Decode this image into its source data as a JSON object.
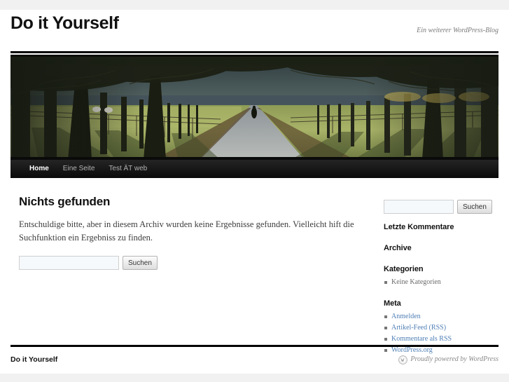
{
  "site": {
    "title": "Do it Yourself",
    "description": "Ein weiterer WordPress-Blog"
  },
  "header_image": {
    "icon": "tree-lined-path-photo",
    "alt": "Allee mit Bäumen und Weg"
  },
  "nav": {
    "items": [
      {
        "label": "Home",
        "current": true
      },
      {
        "label": "Eine Seite",
        "current": false
      },
      {
        "label": "Test ÄT web",
        "current": false
      }
    ]
  },
  "main": {
    "title": "Nichts gefunden",
    "body": "Entschuldige bitte, aber in diesem Archiv wurden keine Ergebnisse gefunden. Vielleicht hift die Suchfunktion ein Ergebniss zu finden.",
    "search": {
      "value": "",
      "placeholder": "",
      "button_label": "Suchen"
    }
  },
  "sidebar": {
    "search": {
      "value": "",
      "placeholder": "",
      "button_label": "Suchen"
    },
    "recent_comments": {
      "title": "Letzte Kommentare"
    },
    "archives": {
      "title": "Archive"
    },
    "categories": {
      "title": "Kategorien",
      "items": [
        {
          "label": "Keine Kategorien",
          "link": false
        }
      ]
    },
    "meta": {
      "title": "Meta",
      "items": [
        {
          "label": "Anmelden",
          "link": true
        },
        {
          "label": "Artikel-Feed (RSS)",
          "link": true
        },
        {
          "label": "Kommentare als RSS",
          "link": true
        },
        {
          "label": "WordPress.org",
          "link": true
        }
      ]
    }
  },
  "footer": {
    "title": "Do it Yourself",
    "credit": "Proudly powered by WordPress",
    "credit_icon": "wordpress-logo-icon"
  },
  "colors": {
    "page_background": "#f1f1f1",
    "sheet": "#ffffff",
    "rule": "#000000",
    "nav_background": "#222222",
    "link": "#4f7fb5",
    "muted_text": "#7a7a7a"
  }
}
